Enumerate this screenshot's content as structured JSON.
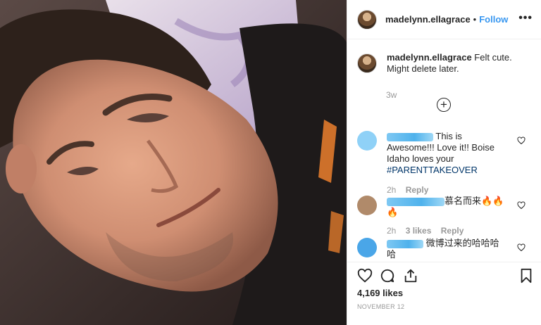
{
  "post": {
    "username": "madelynn.ellagrace",
    "separator": "•",
    "follow_label": "Follow",
    "more_label": "•••"
  },
  "caption": {
    "username": "madelynn.ellagrace",
    "text": "Felt cute. Might delete later.",
    "time": "3w"
  },
  "load_more": {
    "label": "+"
  },
  "comments": [
    {
      "text_pre": " This is Awesome!!! Love it!! Boise Idaho loves your ",
      "hashtag": "#PARENTTAKEOVER",
      "time": "2h",
      "reply": "Reply",
      "avatar_color": "#8fd1f7"
    },
    {
      "text_pre": "慕名而来🔥🔥🔥",
      "hashtag": "",
      "time": "2h",
      "likes": "3 likes",
      "reply": "Reply",
      "avatar_color": "#b08a6a"
    },
    {
      "text_pre": " 微博过来的哈哈哈哈",
      "hashtag": "",
      "avatar_color": "#4aa6e8"
    }
  ],
  "actions": {
    "icons": [
      "heart-icon",
      "comment-icon",
      "share-icon",
      "bookmark-icon"
    ],
    "likes": "4,169 likes",
    "date": "NOVEMBER 12"
  },
  "colors": {
    "link": "#3897f0",
    "hashtag": "#003569",
    "muted": "#999999"
  }
}
